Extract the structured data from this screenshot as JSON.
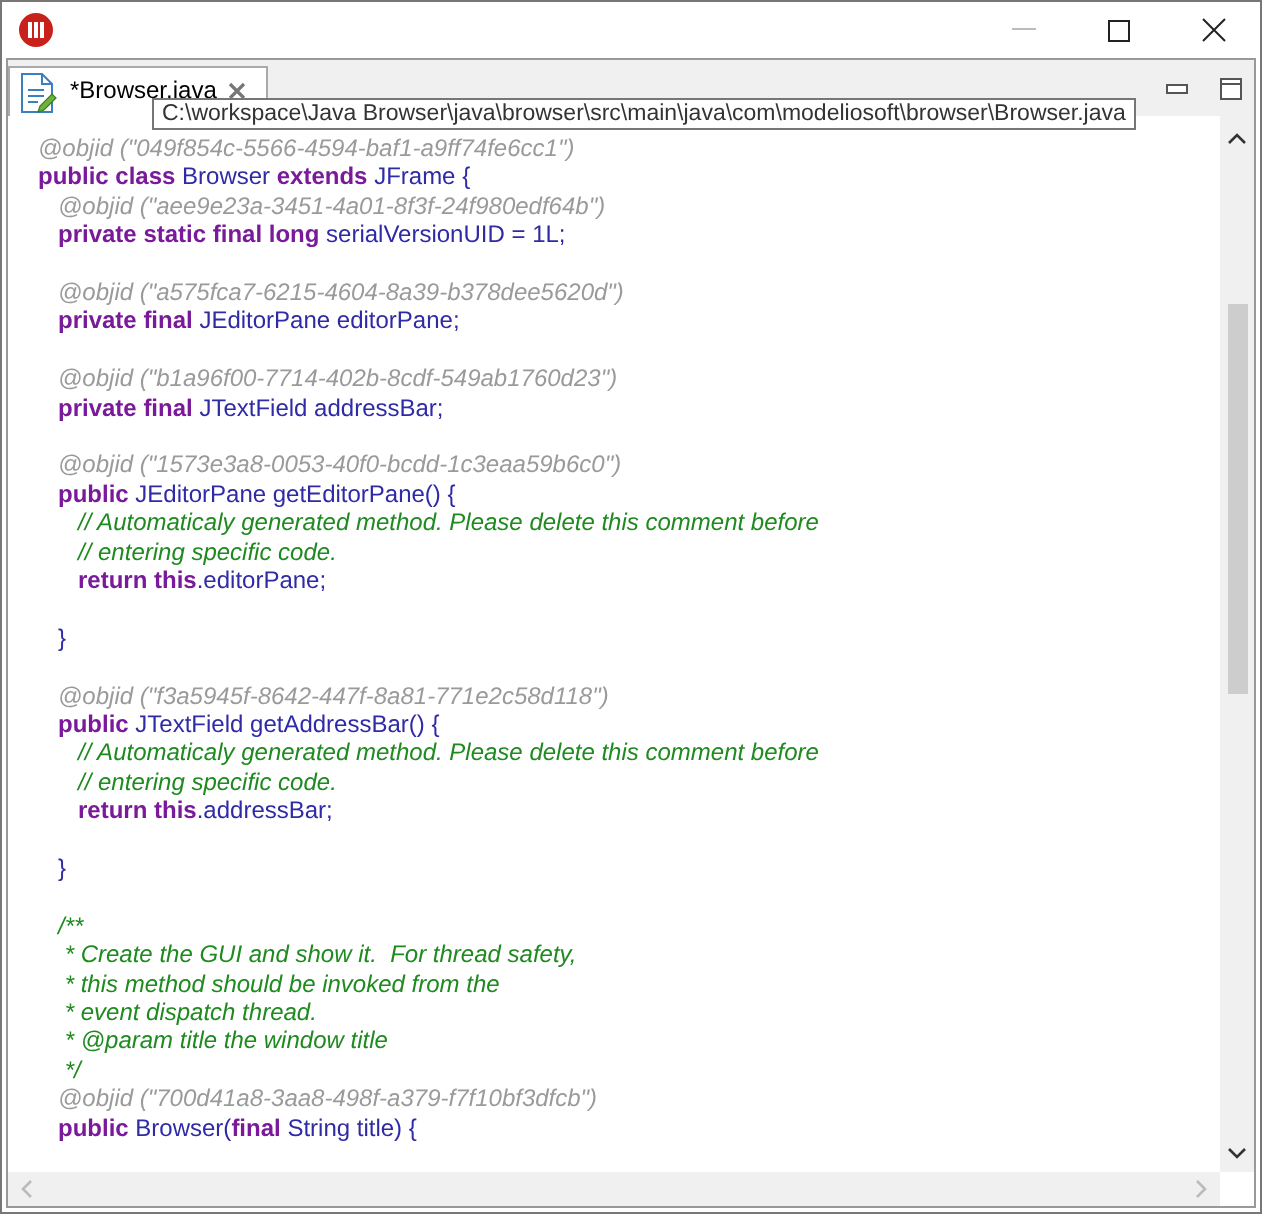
{
  "tab": {
    "label": "*Browser.java",
    "selected": true
  },
  "tooltip": "C:\\workspace\\Java Browser\\java\\browser\\src\\main\\java\\com\\modeliosoft\\browser\\Browser.java",
  "blocks": [
    {
      "lines": [
        [
          {
            "kind": "annotation",
            "text": "@objid (\"049f854c-5566-4594-baf1-a9ff74fe6cc1\")"
          }
        ],
        [
          {
            "kind": "keyword",
            "text": "public class "
          },
          {
            "kind": "plain",
            "text": "Browser "
          },
          {
            "kind": "keyword",
            "text": "extends "
          },
          {
            "kind": "plain",
            "text": "JFrame {"
          }
        ],
        [
          {
            "kind": "annotation",
            "text": "   @objid (\"aee9e23a-3451-4a01-8f3f-24f980edf64b\")"
          }
        ],
        [
          {
            "kind": "keyword",
            "text": "   private static final long "
          },
          {
            "kind": "plain",
            "text": "serialVersionUID = 1L;"
          }
        ]
      ]
    },
    {
      "lines": [
        [
          {
            "kind": "annotation",
            "text": "   @objid (\"a575fca7-6215-4604-8a39-b378dee5620d\")"
          }
        ],
        [
          {
            "kind": "keyword",
            "text": "   private final "
          },
          {
            "kind": "plain",
            "text": "JEditorPane editorPane;"
          }
        ]
      ]
    },
    {
      "lines": [
        [
          {
            "kind": "annotation",
            "text": "   @objid (\"b1a96f00-7714-402b-8cdf-549ab1760d23\")"
          }
        ],
        [
          {
            "kind": "keyword",
            "text": "   private final "
          },
          {
            "kind": "plain",
            "text": "JTextField addressBar;"
          }
        ]
      ]
    },
    {
      "lines": [
        [
          {
            "kind": "annotation",
            "text": "   @objid (\"1573e3a8-0053-40f0-bcdd-1c3eaa59b6c0\")"
          }
        ],
        [
          {
            "kind": "keyword",
            "text": "   public "
          },
          {
            "kind": "plain",
            "text": "JEditorPane getEditorPane() {"
          }
        ],
        [
          {
            "kind": "comment",
            "text": "      // Automaticaly generated method. Please delete this comment before"
          }
        ],
        [
          {
            "kind": "comment",
            "text": "      // entering specific code."
          }
        ],
        [
          {
            "kind": "keyword",
            "text": "      return this"
          },
          {
            "kind": "plain",
            "text": ".editorPane;"
          }
        ]
      ]
    },
    {
      "lines": [
        [
          {
            "kind": "plain",
            "text": "   }"
          }
        ]
      ]
    },
    {
      "lines": [
        [
          {
            "kind": "annotation",
            "text": "   @objid (\"f3a5945f-8642-447f-8a81-771e2c58d118\")"
          }
        ],
        [
          {
            "kind": "keyword",
            "text": "   public "
          },
          {
            "kind": "plain",
            "text": "JTextField getAddressBar() {"
          }
        ],
        [
          {
            "kind": "comment",
            "text": "      // Automaticaly generated method. Please delete this comment before"
          }
        ],
        [
          {
            "kind": "comment",
            "text": "      // entering specific code."
          }
        ],
        [
          {
            "kind": "keyword",
            "text": "      return this"
          },
          {
            "kind": "plain",
            "text": ".addressBar;"
          }
        ]
      ]
    },
    {
      "lines": [
        [
          {
            "kind": "plain",
            "text": "   }"
          }
        ]
      ]
    },
    {
      "lines": [
        [
          {
            "kind": "comment",
            "text": "   /**"
          }
        ],
        [
          {
            "kind": "comment",
            "text": "    * Create the GUI and show it.  For thread safety,"
          }
        ],
        [
          {
            "kind": "comment",
            "text": "    * this method should be invoked from the"
          }
        ],
        [
          {
            "kind": "comment",
            "text": "    * event dispatch thread."
          }
        ],
        [
          {
            "kind": "comment",
            "text": "    * @param title the window title"
          }
        ],
        [
          {
            "kind": "comment",
            "text": "    */"
          }
        ],
        [
          {
            "kind": "annotation",
            "text": "   @objid (\"700d41a8-3aa8-498f-a379-f7f10bf3dfcb\")"
          }
        ],
        [
          {
            "kind": "keyword",
            "text": "   public "
          },
          {
            "kind": "plain",
            "text": "Browser("
          },
          {
            "kind": "keyword",
            "text": "final "
          },
          {
            "kind": "plain",
            "text": "String title) {"
          }
        ]
      ]
    }
  ]
}
